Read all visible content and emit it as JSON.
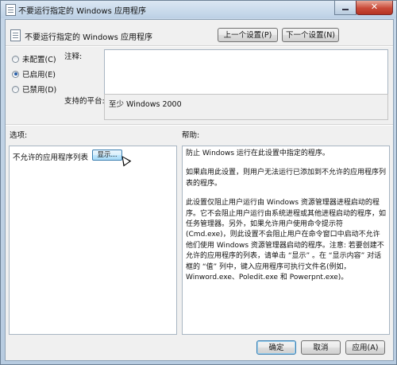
{
  "window": {
    "title": "不要运行指定的 Windows 应用程序"
  },
  "header": {
    "title": "不要运行指定的 Windows 应用程序",
    "prev_label": "上一个设置(P)",
    "next_label": "下一个设置(N)"
  },
  "state": {
    "options": [
      {
        "label": "未配置(C)",
        "selected": false
      },
      {
        "label": "已启用(E)",
        "selected": true
      },
      {
        "label": "已禁用(D)",
        "selected": false
      }
    ]
  },
  "comment": {
    "label": "注释:",
    "value": ""
  },
  "platform": {
    "label": "支持的平台:",
    "value": "至少 Windows 2000"
  },
  "options_section": {
    "label": "选项:",
    "item_label": "不允许的应用程序列表",
    "show_button": "显示..."
  },
  "help_section": {
    "label": "帮助:",
    "paragraphs": [
      "防止 Windows 运行在此设置中指定的程序。",
      "如果启用此设置，则用户无法运行已添加到不允许的应用程序列表的程序。",
      "此设置仅阻止用户运行由 Windows 资源管理器进程启动的程序。它不会阻止用户运行由系统进程或其他进程启动的程序，如任务管理器。另外，如果允许用户使用命令提示符(Cmd.exe)，则此设置不会阻止用户在命令窗口中启动不允许他们使用 Windows 资源管理器启动的程序。注意: 若要创建不允许的应用程序的列表，请单击 “显示” 。在 “显示内容” 对话框的 “值” 列中，键入应用程序可执行文件名(例如，Winword.exe、Poledit.exe 和 Powerpnt.exe)。"
    ]
  },
  "footer": {
    "ok": "确定",
    "cancel": "取消",
    "apply": "应用(A)"
  },
  "colors": {
    "accent": "#2a5fa8",
    "close": "#c94a38"
  }
}
